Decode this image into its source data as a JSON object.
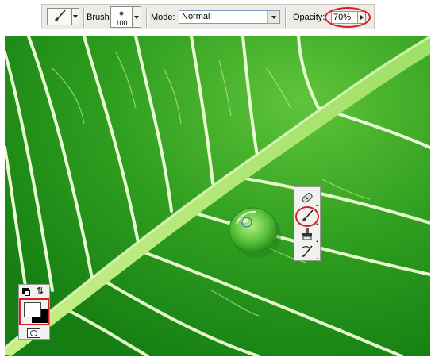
{
  "options_bar": {
    "brush_label": "Brush:",
    "brush_size": "100",
    "mode_label": "Mode:",
    "mode_value": "Normal",
    "opacity_label": "Opacity:",
    "opacity_value": "70%"
  },
  "tools": {
    "group": [
      "healing-brush-icon",
      "brush-icon",
      "clone-stamp-icon",
      "history-brush-icon"
    ],
    "active": "brush-icon"
  },
  "colors": {
    "foreground": "#ffffff",
    "background": "#000000",
    "highlight": "#d3202a"
  }
}
